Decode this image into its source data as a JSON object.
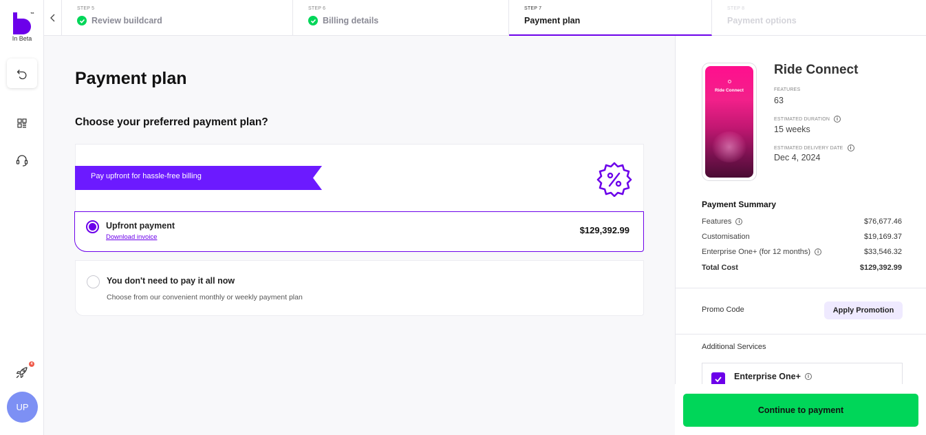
{
  "brand": {
    "tm": "™",
    "beta_label": "In Beta"
  },
  "rail": {
    "icons": [
      "undo-icon",
      "grid-icon",
      "headset-icon",
      "rocket-icon"
    ],
    "notification_count": "4",
    "avatar_initials": "UP"
  },
  "stepper": {
    "steps": [
      {
        "num": "STEP 5",
        "label": "Review buildcard",
        "state": "done"
      },
      {
        "num": "STEP 6",
        "label": "Billing details",
        "state": "done"
      },
      {
        "num": "STEP 7",
        "label": "Payment plan",
        "state": "active"
      },
      {
        "num": "STEP 8",
        "label": "Payment options",
        "state": "future"
      }
    ]
  },
  "main": {
    "title": "Payment plan",
    "subtitle": "Choose your preferred payment plan?",
    "ribbon_text": "Pay upfront for hassle-free billing",
    "option_upfront": {
      "title": "Upfront payment",
      "link": "Download invoice",
      "price": "$129,392.99",
      "selected": true
    },
    "option_installments": {
      "title": "You don't need to pay it all now",
      "description": "Choose from our convenient monthly or weekly payment plan",
      "selected": false
    }
  },
  "summary": {
    "phone_label": "Ride Connect",
    "app_name": "Ride Connect",
    "features_label": "FEATURES",
    "features_value": "63",
    "duration_label": "ESTIMATED DURATION",
    "duration_value": "15 weeks",
    "delivery_label": "ESTIMATED DELIVERY DATE",
    "delivery_value": "Dec 4, 2024",
    "payment_summary_title": "Payment Summary",
    "rows": [
      {
        "label": "Features",
        "value": "$76,677.46"
      },
      {
        "label": "Customisation",
        "value": "$19,169.37"
      },
      {
        "label": "Enterprise One+ (for 12 months)",
        "value": "$33,546.32"
      },
      {
        "label": "Total Cost",
        "value": "$129,392.99"
      }
    ],
    "promo_label": "Promo Code",
    "promo_button": "Apply Promotion",
    "additional_services_label": "Additional Services",
    "service_name": "Enterprise One+",
    "service_checked": true,
    "cta": "Continue to payment"
  },
  "colors": {
    "accent": "#6c00ea",
    "success": "#00d659",
    "avatar": "#7d90f4"
  }
}
